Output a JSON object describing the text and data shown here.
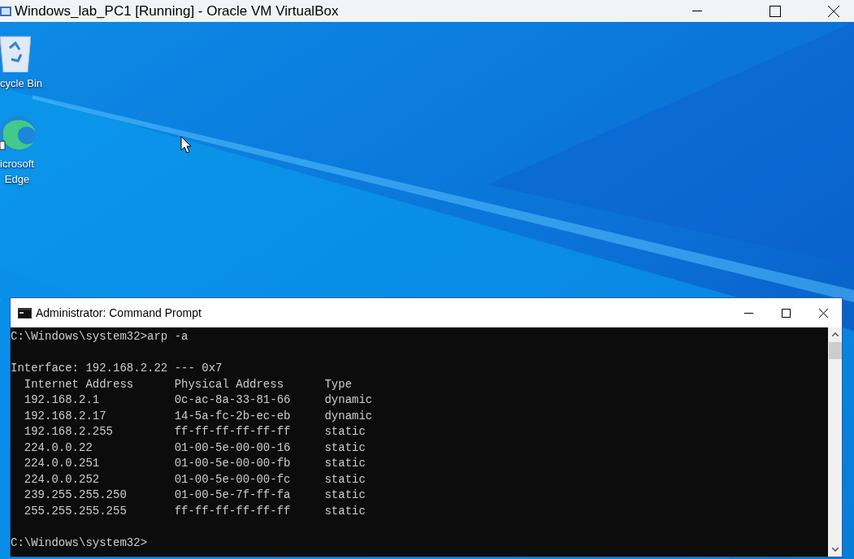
{
  "vm_window": {
    "title": "Windows_lab_PC1 [Running] - Oracle VM VirtualBox"
  },
  "desktop_icons": [
    {
      "kind": "recycle",
      "label": "cycle Bin"
    },
    {
      "kind": "edge",
      "label": "icrosoft\nEdge"
    }
  ],
  "cmd_window": {
    "title": "Administrator: Command Prompt",
    "command_line": "C:\\Windows\\system32>arp -a",
    "interface_line": "Interface: 192.168.2.22 --- 0x7",
    "columns": [
      "Internet Address",
      "Physical Address",
      "Type"
    ],
    "rows": [
      [
        "192.168.2.1",
        "0c-ac-8a-33-81-66",
        "dynamic"
      ],
      [
        "192.168.2.17",
        "14-5a-fc-2b-ec-eb",
        "dynamic"
      ],
      [
        "192.168.2.255",
        "ff-ff-ff-ff-ff-ff",
        "static"
      ],
      [
        "224.0.0.22",
        "01-00-5e-00-00-16",
        "static"
      ],
      [
        "224.0.0.251",
        "01-00-5e-00-00-fb",
        "static"
      ],
      [
        "224.0.0.252",
        "01-00-5e-00-00-fc",
        "static"
      ],
      [
        "239.255.255.250",
        "01-00-5e-7f-ff-fa",
        "static"
      ],
      [
        "255.255.255.255",
        "ff-ff-ff-ff-ff-ff",
        "static"
      ]
    ],
    "prompt_line": "C:\\Windows\\system32>"
  }
}
